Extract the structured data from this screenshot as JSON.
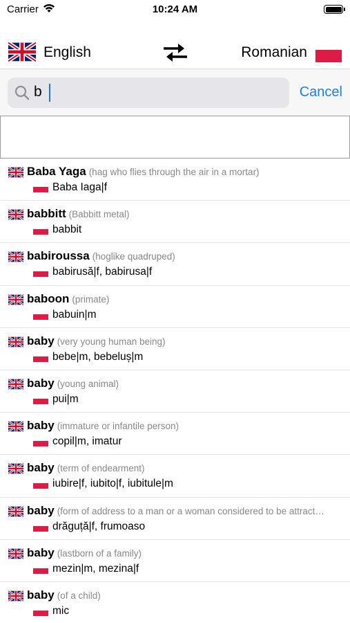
{
  "status_bar": {
    "carrier": "Carrier",
    "time": "10:24 AM"
  },
  "languages": {
    "source": "English",
    "target": "Romanian"
  },
  "search": {
    "query": "b",
    "cancel_label": "Cancel"
  },
  "colors": {
    "accent": "#1a7ff0",
    "ro_flag": "#dc1c46",
    "uk_blue": "#012169",
    "uk_red": "#C8102E"
  },
  "results": [
    {
      "term": "Baba Yaga",
      "note": "(hag who flies through the air in a mortar)",
      "translation": "Baba Iaga|f"
    },
    {
      "term": "babbitt",
      "note": "(Babbitt metal)",
      "translation": "babbit"
    },
    {
      "term": "babiroussa",
      "note": "(hoglike quadruped)",
      "translation": "babirusă|f, babirusa|f"
    },
    {
      "term": "baboon",
      "note": "(primate)",
      "translation": "babuin|m"
    },
    {
      "term": "baby",
      "note": "(very young human being)",
      "translation": "bebe|m, bebeluș|m"
    },
    {
      "term": "baby",
      "note": "(young animal)",
      "translation": "pui|m"
    },
    {
      "term": "baby",
      "note": "(immature or infantile person)",
      "translation": "copil|m, imatur"
    },
    {
      "term": "baby",
      "note": "(term of endearment)",
      "translation": "iubire|f, iubito|f, iubitule|m"
    },
    {
      "term": "baby",
      "note": "(form of address to a man or a woman considered to be attract…",
      "translation": "drăguță|f, frumoaso"
    },
    {
      "term": "baby",
      "note": "(lastborn of a family)",
      "translation": "mezin|m, mezina|f"
    },
    {
      "term": "baby",
      "note": "(of a child)",
      "translation": "mic"
    }
  ]
}
